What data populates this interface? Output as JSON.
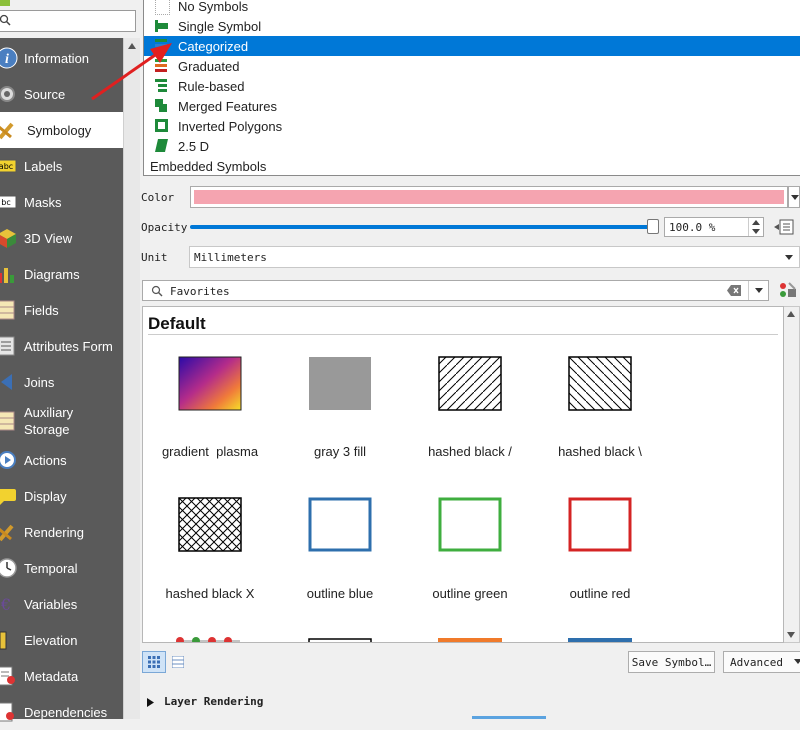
{
  "sidebar": {
    "search_placeholder": "",
    "items": [
      {
        "label": "Information",
        "icon": "info-icon"
      },
      {
        "label": "Source",
        "icon": "source-icon"
      },
      {
        "label": "Symbology",
        "icon": "symbology-icon",
        "active": true
      },
      {
        "label": "Labels",
        "icon": "labels-icon"
      },
      {
        "label": "Masks",
        "icon": "masks-icon"
      },
      {
        "label": "3D View",
        "icon": "3d-view-icon"
      },
      {
        "label": "Diagrams",
        "icon": "diagrams-icon"
      },
      {
        "label": "Fields",
        "icon": "fields-icon"
      },
      {
        "label": "Attributes Form",
        "icon": "attributes-form-icon"
      },
      {
        "label": "Joins",
        "icon": "joins-icon"
      },
      {
        "label": "Auxiliary Storage",
        "icon": "auxiliary-storage-icon"
      },
      {
        "label": "Actions",
        "icon": "actions-icon"
      },
      {
        "label": "Display",
        "icon": "display-icon"
      },
      {
        "label": "Rendering",
        "icon": "rendering-icon"
      },
      {
        "label": "Temporal",
        "icon": "temporal-icon"
      },
      {
        "label": "Variables",
        "icon": "variables-icon"
      },
      {
        "label": "Elevation",
        "icon": "elevation-icon"
      },
      {
        "label": "Metadata",
        "icon": "metadata-icon"
      },
      {
        "label": "Dependencies",
        "icon": "dependencies-icon"
      }
    ]
  },
  "renderer_list": {
    "items": [
      {
        "label": "No Symbols"
      },
      {
        "label": "Single Symbol"
      },
      {
        "label": "Categorized",
        "selected": true
      },
      {
        "label": "Graduated"
      },
      {
        "label": "Rule-based"
      },
      {
        "label": "Merged Features"
      },
      {
        "label": "Inverted Polygons"
      },
      {
        "label": "2.5 D"
      }
    ],
    "footer": "Embedded Symbols"
  },
  "props": {
    "color_label": "Color",
    "color_value": "#f5a4b0",
    "opacity_label": "Opacity",
    "opacity_value": "100.0 %",
    "opacity_fraction": 1.0,
    "unit_label": "Unit",
    "unit_value": "Millimeters"
  },
  "library": {
    "search_value": "Favorites",
    "group_title": "Default",
    "symbols": [
      {
        "label": "gradient  plasma",
        "icon": "gradient-plasma-swatch"
      },
      {
        "label": "gray 3 fill",
        "icon": "gray-fill-swatch"
      },
      {
        "label": "hashed black /",
        "icon": "hashed-forward-swatch"
      },
      {
        "label": "hashed black \\",
        "icon": "hashed-backward-swatch"
      },
      {
        "label": "hashed black X",
        "icon": "hashed-cross-swatch"
      },
      {
        "label": "outline blue",
        "icon": "outline-blue-swatch"
      },
      {
        "label": "outline green",
        "icon": "outline-green-swatch"
      },
      {
        "label": "outline red",
        "icon": "outline-red-swatch"
      }
    ]
  },
  "buttons": {
    "save_symbol": "Save Symbol…",
    "advanced": "Advanced"
  },
  "layer_rendering": "Layer Rendering",
  "colors": {
    "selection": "#0078d7",
    "sidebar_bg": "#5a5a5a",
    "outline_blue": "#2e6fad",
    "outline_green": "#3fae3f",
    "outline_red": "#d42424",
    "annotation_arrow": "#e02020"
  }
}
